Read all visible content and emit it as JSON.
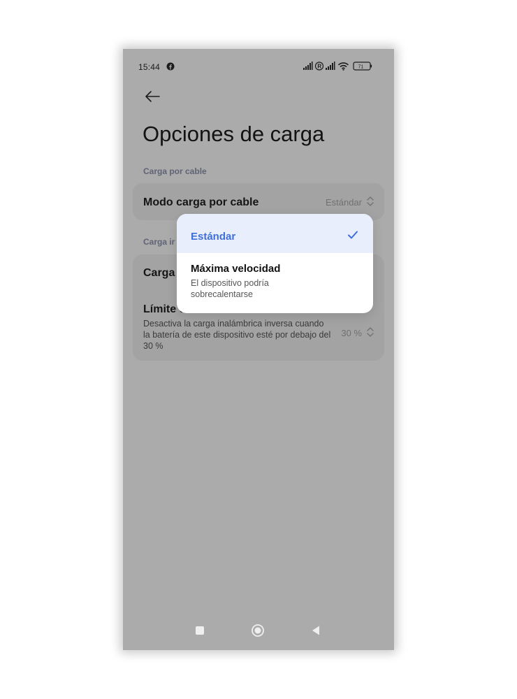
{
  "status_bar": {
    "time": "15:44",
    "battery": "71"
  },
  "page": {
    "title": "Opciones de carga"
  },
  "sections": [
    {
      "header": "Carga por cable",
      "rows": [
        {
          "title": "Modo carga por cable",
          "value": "Estándar"
        }
      ]
    },
    {
      "header": "Carga ir",
      "rows": [
        {
          "title": "Carga"
        },
        {
          "title": "Límite d",
          "subtitle": "Desactiva la carga inalámbrica inversa cuando la batería de este dispositivo esté por debajo del 30 %",
          "value": "30 %"
        }
      ]
    }
  ],
  "popup": {
    "options": [
      {
        "label": "Estándar",
        "selected": true
      },
      {
        "label": "Máxima velocidad",
        "subtitle": "El dispositivo podría sobrecalentarse",
        "selected": false
      }
    ]
  },
  "colors": {
    "accent": "#3f6fd8",
    "dimmed_background": "#ababab",
    "selected_option_bg": "#e8eefb"
  },
  "icons": [
    "facebook-icon",
    "signal-icon",
    "wifi-icon",
    "battery-icon",
    "back-arrow-icon",
    "up-down-chevron-icon",
    "checkmark-icon",
    "recents-icon",
    "home-icon",
    "back-nav-icon"
  ]
}
